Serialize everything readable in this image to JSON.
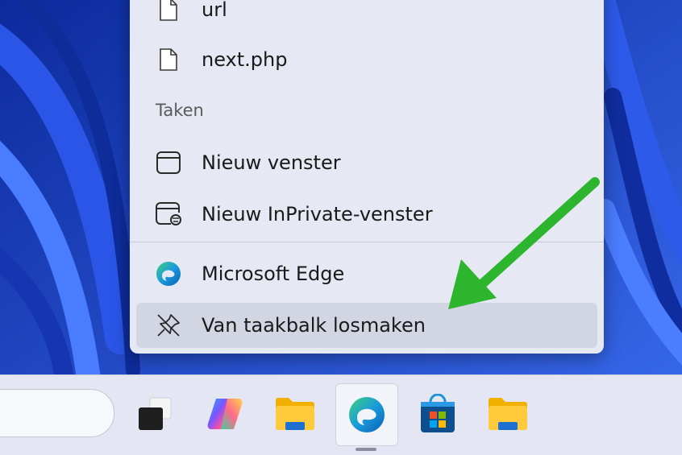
{
  "jumplist": {
    "recent_items": [
      {
        "label": "url",
        "icon": "file-icon"
      },
      {
        "label": "next.php",
        "icon": "file-icon"
      }
    ],
    "tasks_header": "Taken",
    "tasks": [
      {
        "label": "Nieuw venster",
        "icon": "window-icon"
      },
      {
        "label": "Nieuw InPrivate-venster",
        "icon": "inprivate-window-icon"
      }
    ],
    "app_item": {
      "label": "Microsoft Edge",
      "icon": "edge-icon"
    },
    "unpin_item": {
      "label": "Van taakbalk losmaken",
      "icon": "unpin-icon"
    }
  },
  "taskbar": {
    "buttons": [
      {
        "name": "task-view",
        "icon": "task-view-icon"
      },
      {
        "name": "copilot",
        "icon": "copilot-icon"
      },
      {
        "name": "file-explorer",
        "icon": "folder-icon"
      },
      {
        "name": "edge",
        "icon": "edge-icon",
        "active": true
      },
      {
        "name": "microsoft-store",
        "icon": "store-icon"
      },
      {
        "name": "file-explorer-2",
        "icon": "folder-icon"
      }
    ]
  },
  "colors": {
    "annotation_arrow": "#2db52d",
    "menu_background": "#e6e8f3",
    "taskbar_background": "#e4e7f3",
    "wallpaper": "#1d3fb8"
  }
}
